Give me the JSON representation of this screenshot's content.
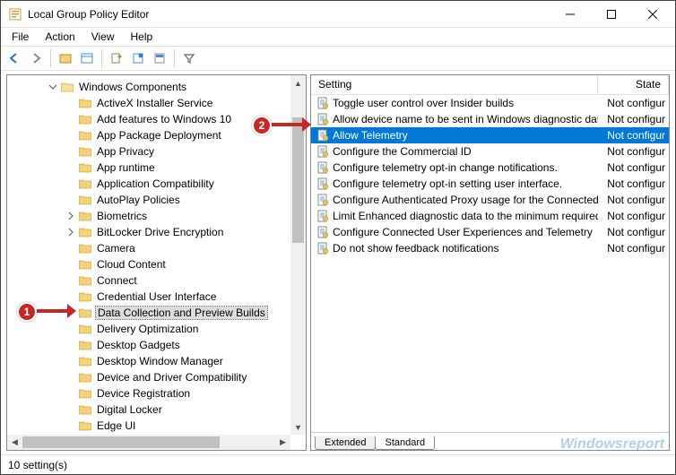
{
  "window": {
    "title": "Local Group Policy Editor"
  },
  "menu": {
    "items": [
      "File",
      "Action",
      "View",
      "Help"
    ]
  },
  "tree": {
    "root": {
      "label": "Windows Components",
      "children": [
        "ActiveX Installer Service",
        "Add features to Windows 10",
        "App Package Deployment",
        "App Privacy",
        "App runtime",
        "Application Compatibility",
        "AutoPlay Policies",
        "Biometrics",
        "BitLocker Drive Encryption",
        "Camera",
        "Cloud Content",
        "Connect",
        "Credential User Interface",
        "Data Collection and Preview Builds",
        "Delivery Optimization",
        "Desktop Gadgets",
        "Desktop Window Manager",
        "Device and Driver Compatibility",
        "Device Registration",
        "Digital Locker",
        "Edge UI"
      ],
      "expandable_indexes": [
        7,
        8
      ],
      "selected_index": 13
    }
  },
  "list": {
    "columns": {
      "setting": "Setting",
      "state": "State"
    },
    "rows": [
      {
        "setting": "Toggle user control over Insider builds",
        "state": "Not configur"
      },
      {
        "setting": "Allow device name to be sent in Windows diagnostic data",
        "state": "Not configur"
      },
      {
        "setting": "Allow Telemetry",
        "state": "Not configur",
        "selected": true
      },
      {
        "setting": "Configure the Commercial ID",
        "state": "Not configur"
      },
      {
        "setting": "Configure telemetry opt-in change notifications.",
        "state": "Not configur"
      },
      {
        "setting": "Configure telemetry opt-in setting user interface.",
        "state": "Not configur"
      },
      {
        "setting": "Configure Authenticated Proxy usage for the Connected Us...",
        "state": "Not configur"
      },
      {
        "setting": "Limit Enhanced diagnostic data to the minimum required b...",
        "state": "Not configur"
      },
      {
        "setting": "Configure Connected User Experiences and Telemetry",
        "state": "Not configur"
      },
      {
        "setting": "Do not show feedback notifications",
        "state": "Not configur"
      }
    ]
  },
  "tabs": {
    "extended": "Extended",
    "standard": "Standard",
    "active": "standard"
  },
  "status": {
    "text": "10 setting(s)"
  },
  "annotations": {
    "badge1": "1",
    "badge2": "2"
  },
  "watermark": "Windowsreport"
}
